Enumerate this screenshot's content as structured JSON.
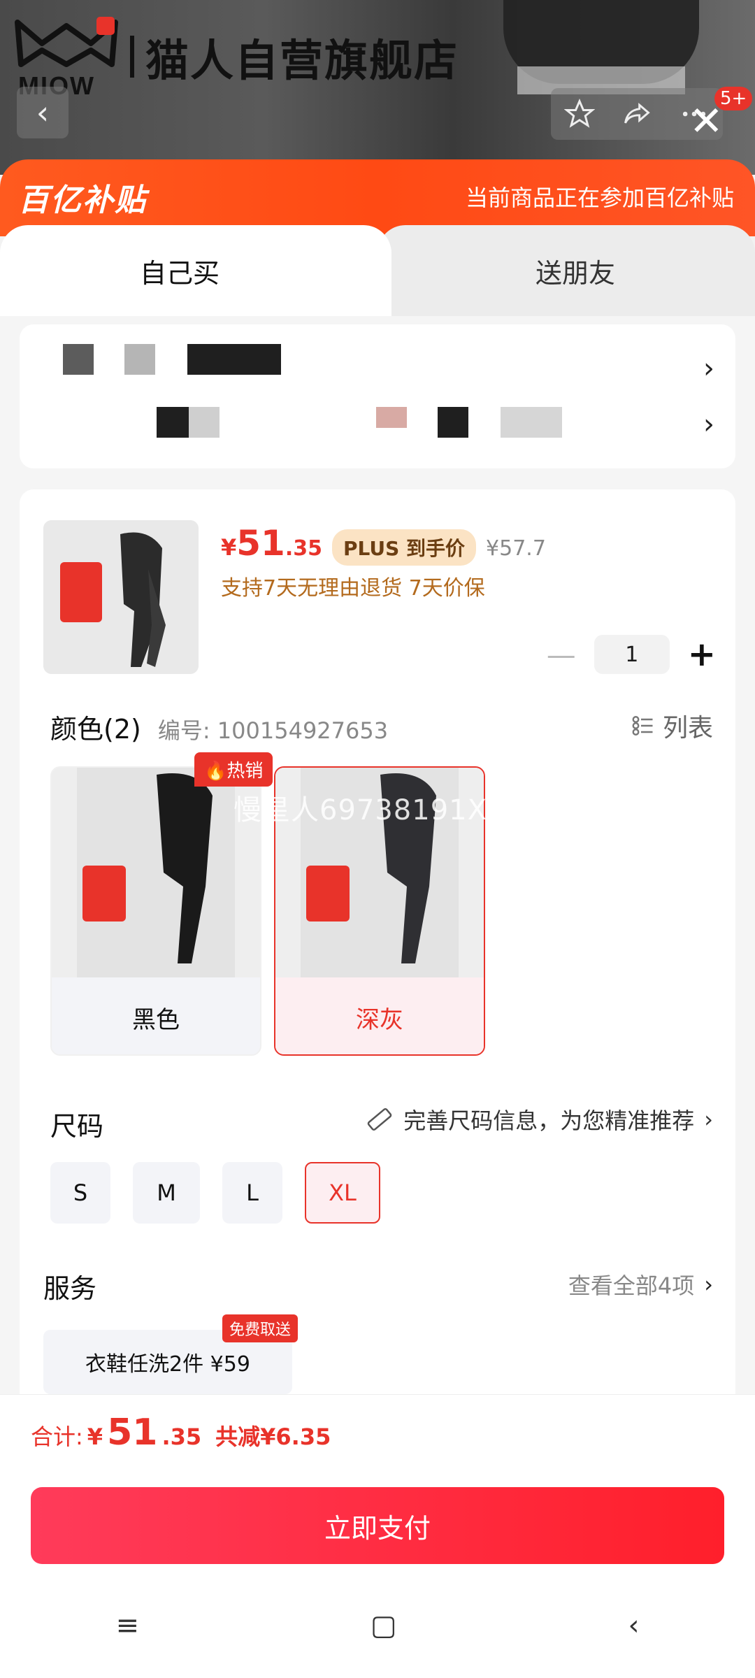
{
  "header": {
    "brand_word": "MIOW",
    "brand_name": "猫人自营旗舰店",
    "cart_badge": "5+"
  },
  "subsidy": {
    "logo": "百亿补贴",
    "note": "当前商品正在参加百亿补贴"
  },
  "tabs": [
    {
      "label": "自己买",
      "active": true
    },
    {
      "label": "送朋友",
      "active": false
    }
  ],
  "product": {
    "price_symbol": "¥",
    "price_int": "51",
    "price_dec": ".35",
    "plus_label": "PLUS 到手价",
    "old_price": "¥57.7",
    "returns": "支持7天无理由退货  7天价保",
    "quantity": "1",
    "color_title": "颜色(2)",
    "color_code": "编号: 100154927653",
    "list_label": "列表",
    "hot_badge": "热销",
    "watermark": "慢星人69738191X",
    "colors": [
      {
        "label": "黑色",
        "selected": false
      },
      {
        "label": "深灰",
        "selected": true
      }
    ],
    "size_title": "尺码",
    "size_hint": "完善尺码信息，为您精准推荐",
    "sizes": [
      {
        "label": "S",
        "selected": false
      },
      {
        "label": "M",
        "selected": false
      },
      {
        "label": "L",
        "selected": false
      },
      {
        "label": "XL",
        "selected": true
      }
    ],
    "service_title": "服务",
    "service_all": "查看全部4项",
    "service_chip": "衣鞋任洗2件  ¥59",
    "service_free": "免费取送"
  },
  "footer": {
    "total_label": "合计:",
    "total_symbol": "¥",
    "total_int": "51",
    "total_dec": ".35",
    "total_saving": "共减¥6.35",
    "pay_label": "立即支付"
  },
  "colors": {
    "accent": "#e8332a",
    "subsidy_orange": "#ff5a1f",
    "pay_gradient_start": "#ff3b5a",
    "pay_gradient_end": "#ff1f2b"
  }
}
